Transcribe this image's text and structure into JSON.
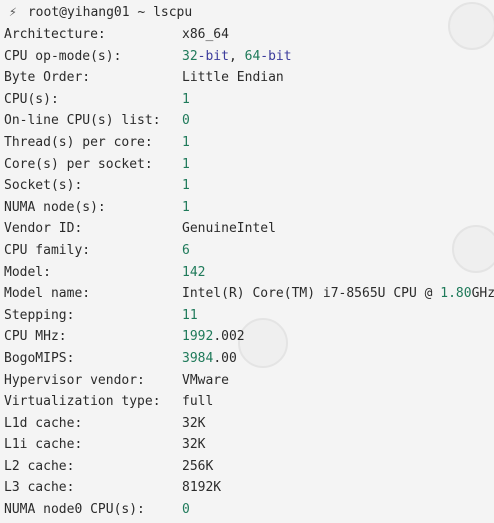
{
  "prompt": {
    "bolt": "⚡",
    "user_host": "root@yihang01",
    "path": "~",
    "command": "lscpu"
  },
  "colors": {
    "number": "#1f7a5a",
    "keyword": "#3b3b9c",
    "text": "#2b2b2b",
    "background": "#f4f4f4"
  },
  "rows": [
    {
      "label": "Architecture:",
      "segments": [
        {
          "t": "x86_64",
          "c": "plain"
        }
      ]
    },
    {
      "label": "CPU op-mode(s):",
      "segments": [
        {
          "t": "32",
          "c": "num"
        },
        {
          "t": "-bit",
          "c": "kw"
        },
        {
          "t": ", ",
          "c": "plain"
        },
        {
          "t": "64",
          "c": "num"
        },
        {
          "t": "-bit",
          "c": "kw"
        }
      ]
    },
    {
      "label": "Byte Order:",
      "segments": [
        {
          "t": "Little Endian",
          "c": "plain"
        }
      ]
    },
    {
      "label": "CPU(s):",
      "segments": [
        {
          "t": "1",
          "c": "num"
        }
      ]
    },
    {
      "label": "On-line CPU(s) list:",
      "segments": [
        {
          "t": "0",
          "c": "num"
        }
      ]
    },
    {
      "label": "Thread(s) per core:",
      "segments": [
        {
          "t": "1",
          "c": "num"
        }
      ]
    },
    {
      "label": "Core(s) per socket:",
      "segments": [
        {
          "t": "1",
          "c": "num"
        }
      ]
    },
    {
      "label": "Socket(s):",
      "segments": [
        {
          "t": "1",
          "c": "num"
        }
      ]
    },
    {
      "label": "NUMA node(s):",
      "segments": [
        {
          "t": "1",
          "c": "num"
        }
      ]
    },
    {
      "label": "Vendor ID:",
      "segments": [
        {
          "t": "GenuineIntel",
          "c": "plain"
        }
      ]
    },
    {
      "label": "CPU family:",
      "segments": [
        {
          "t": "6",
          "c": "num"
        }
      ]
    },
    {
      "label": "Model:",
      "segments": [
        {
          "t": "142",
          "c": "num"
        }
      ]
    },
    {
      "label": "Model name:",
      "segments": [
        {
          "t": "Intel(R) Core(TM) i7-8565U CPU @ ",
          "c": "plain"
        },
        {
          "t": "1.80",
          "c": "num"
        },
        {
          "t": "GHz",
          "c": "plain"
        }
      ]
    },
    {
      "label": "Stepping:",
      "segments": [
        {
          "t": "11",
          "c": "num"
        }
      ]
    },
    {
      "label": "CPU MHz:",
      "segments": [
        {
          "t": "1992",
          "c": "num"
        },
        {
          "t": ".002",
          "c": "plain"
        }
      ]
    },
    {
      "label": "BogoMIPS:",
      "segments": [
        {
          "t": "3984",
          "c": "num"
        },
        {
          "t": ".00",
          "c": "plain"
        }
      ]
    },
    {
      "label": "Hypervisor vendor:",
      "segments": [
        {
          "t": "VMware",
          "c": "plain"
        }
      ]
    },
    {
      "label": "Virtualization type:",
      "segments": [
        {
          "t": "full",
          "c": "plain"
        }
      ]
    },
    {
      "label": "L1d cache:",
      "segments": [
        {
          "t": "32K",
          "c": "plain"
        }
      ]
    },
    {
      "label": "L1i cache:",
      "segments": [
        {
          "t": "32K",
          "c": "plain"
        }
      ]
    },
    {
      "label": "L2 cache:",
      "segments": [
        {
          "t": "256K",
          "c": "plain"
        }
      ]
    },
    {
      "label": "L3 cache:",
      "segments": [
        {
          "t": "8192K",
          "c": "plain"
        }
      ]
    },
    {
      "label": "NUMA node0 CPU(s):",
      "segments": [
        {
          "t": "0",
          "c": "num"
        }
      ]
    }
  ]
}
